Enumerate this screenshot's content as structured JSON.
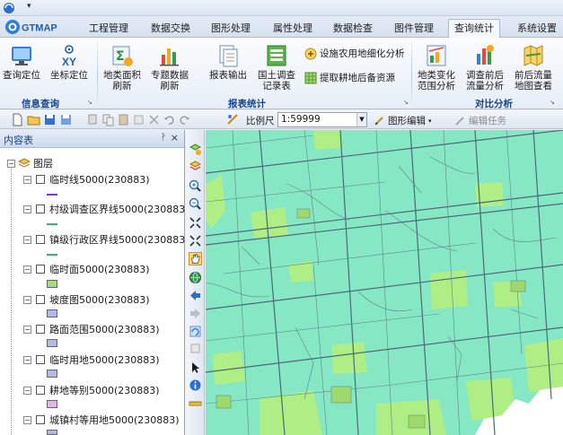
{
  "app": {
    "logo_text": "GTMAP"
  },
  "colors": {
    "map_bg": "#86e7c4",
    "ribbon_group_label": "#15428b"
  },
  "tabs": [
    {
      "label": "工程管理",
      "active": false
    },
    {
      "label": "数据交换",
      "active": false
    },
    {
      "label": "图形处理",
      "active": false
    },
    {
      "label": "属性处理",
      "active": false
    },
    {
      "label": "数据检查",
      "active": false
    },
    {
      "label": "图件管理",
      "active": false
    },
    {
      "label": "查询统计",
      "active": true
    },
    {
      "label": "系统设置",
      "active": false
    }
  ],
  "ribbon": {
    "info_query": {
      "label": "信息查询",
      "query_locate": "查询定位",
      "coord_locate": "坐标定位",
      "coord_icon_text": "XY"
    },
    "report_stats": {
      "label": "报表统计",
      "landclass_area_refresh": [
        "地类面积",
        "刷新"
      ],
      "topic_data_refresh": [
        "专题数据",
        "刷新"
      ],
      "report_output": "报表输出",
      "land_survey_table": [
        "国土调查",
        "记录表"
      ],
      "facility_landuse": "设施农用地细化分析",
      "extract_reserve": "提取耕地后备资源"
    },
    "compare_analysis": {
      "label": "对比分析",
      "landclass_change": [
        "地类变化",
        "范围分析"
      ],
      "flow_analysis": [
        "调查前后",
        "流量分析"
      ],
      "flow_map": [
        "前后流量",
        "地图查看"
      ]
    }
  },
  "toolbar": {
    "scale_label": "比例尺",
    "scale_value": "1:59999",
    "graph_edit": "图形编辑",
    "edit_task": "编辑任务"
  },
  "panel": {
    "title": "内容表",
    "root": "图层",
    "layers": [
      {
        "name": "临时线5000(230883)",
        "symbol": "line",
        "color": "#8a2be2"
      },
      {
        "name": "村级调查区界线5000(230883)",
        "symbol": "line",
        "color": "#3cb371"
      },
      {
        "name": "镇级行政区界线5000(230883)",
        "symbol": "line",
        "color": "#3cb371"
      },
      {
        "name": "临时面5000(230883)",
        "symbol": "fill",
        "color": "#9be07a"
      },
      {
        "name": "坡度图5000(230883)",
        "symbol": "fill",
        "color": "#b7b7ef"
      },
      {
        "name": "路面范围5000(230883)",
        "symbol": "fill",
        "color": "#b7b7ef"
      },
      {
        "name": "临时用地5000(230883)",
        "symbol": "fill",
        "color": "#b7b7ef"
      },
      {
        "name": "耕地等别5000(230883)",
        "symbol": "fill",
        "color": "#e9b1ef"
      },
      {
        "name": "城镇村等用地5000(230883)",
        "symbol": "fill",
        "color": "#b7b7ef"
      }
    ]
  },
  "map_tools": [
    "layer-add-icon",
    "layer-stack-icon",
    "zoom-in-icon",
    "zoom-out-icon",
    "zoom-full-extent-icon",
    "zoom-fixed-icon",
    "pan-hand-icon",
    "globe-icon",
    "back-arrow-icon",
    "forward-arrow-icon",
    "refresh-map-icon",
    "clear-icon",
    "select-arrow-icon",
    "info-icon",
    "measure-icon"
  ]
}
